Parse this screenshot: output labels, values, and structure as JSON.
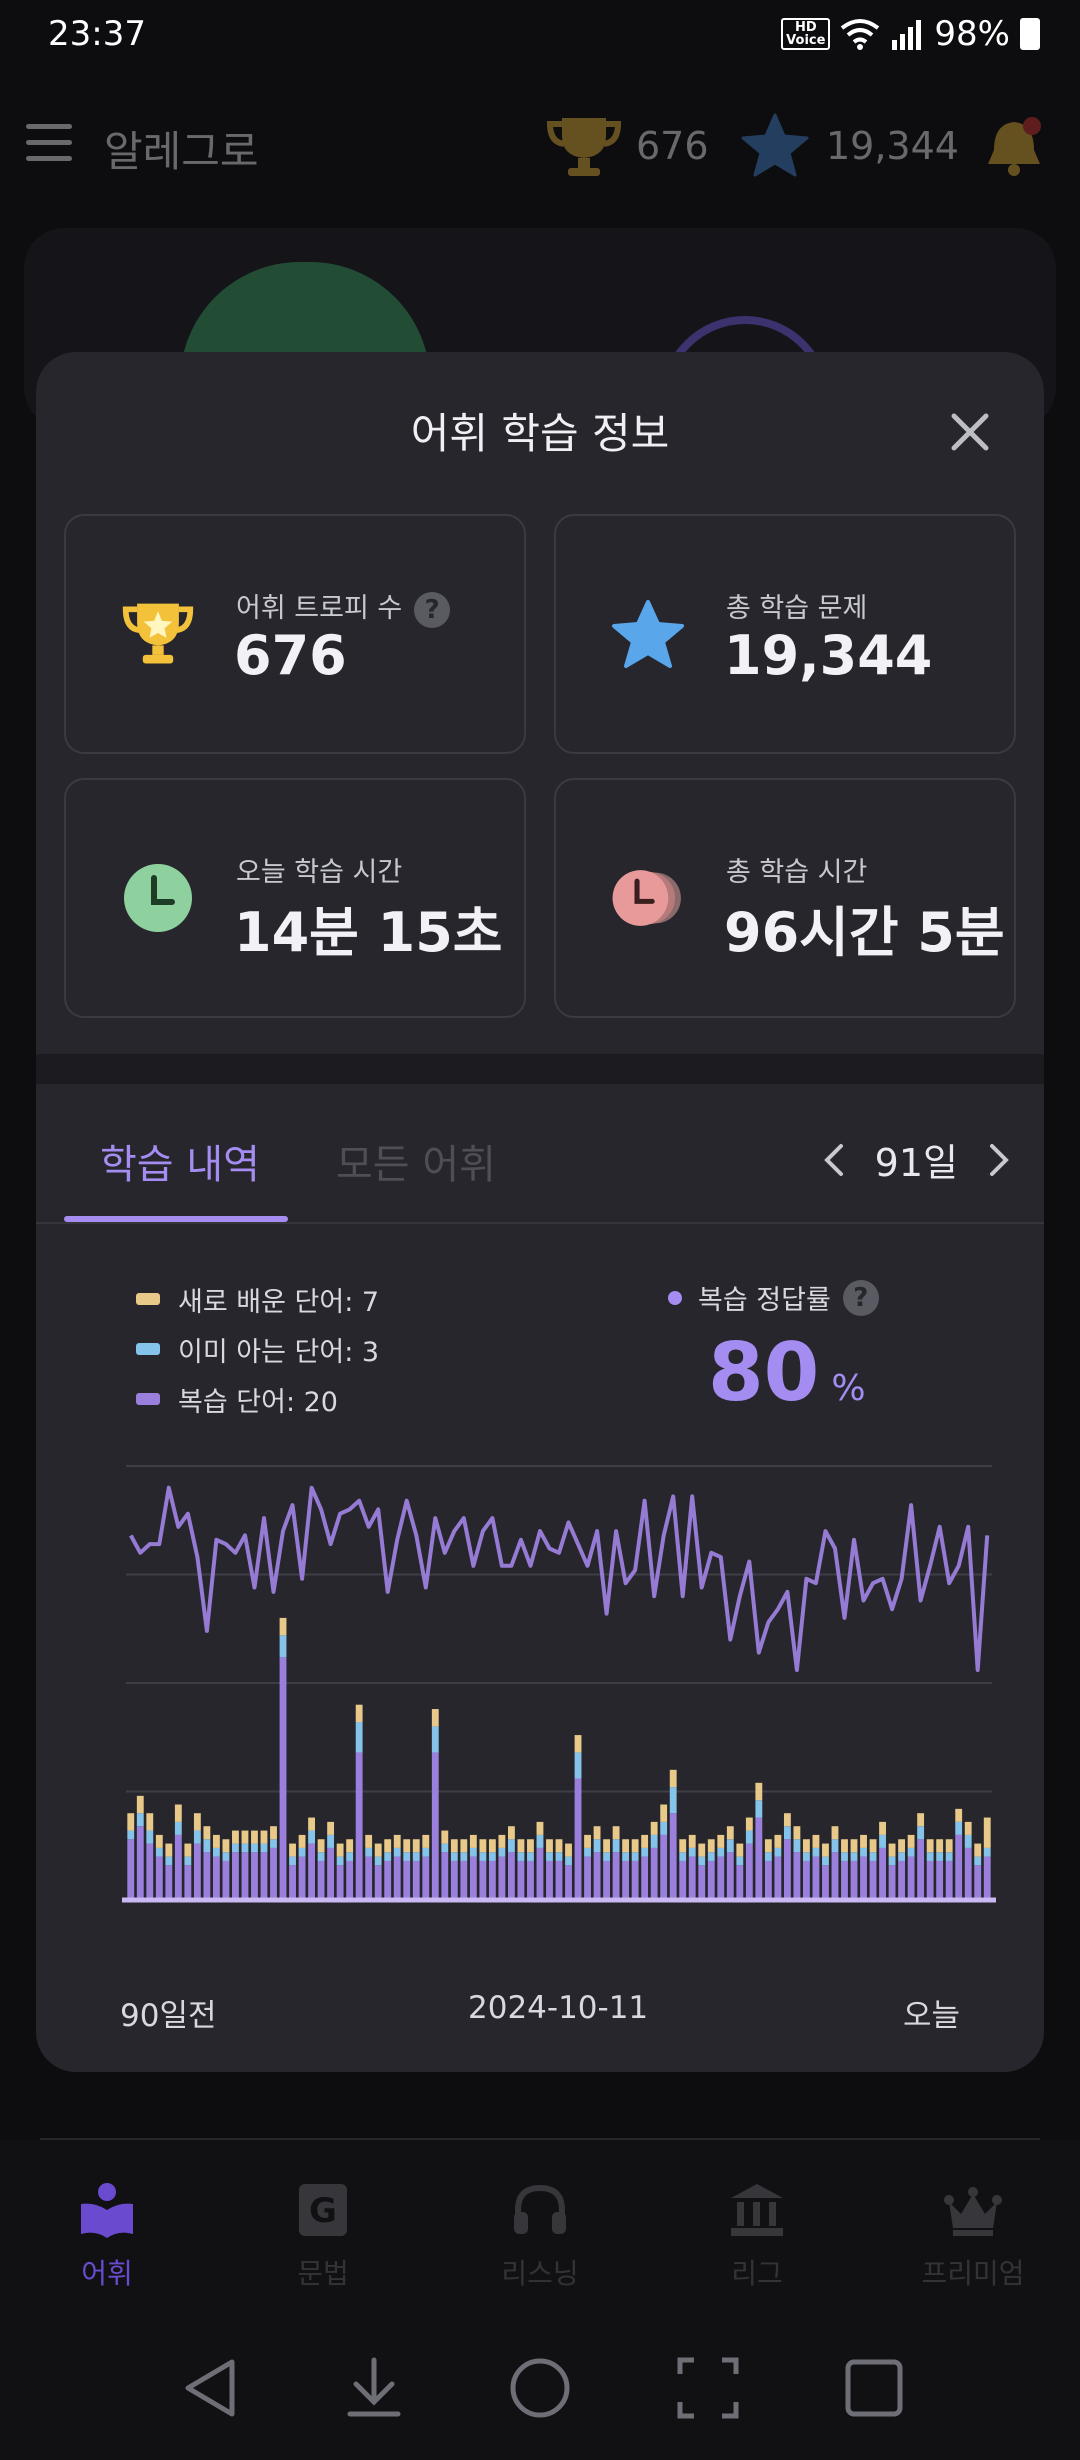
{
  "status": {
    "time": "23:37",
    "hd_top": "HD",
    "hd_bottom": "Voice",
    "battery": "98%"
  },
  "header": {
    "title": "알레그로",
    "trophy_count": "676",
    "star_count": "19,344"
  },
  "modal": {
    "title": "어휘 학습 정보",
    "stats": [
      {
        "label": "어휘 트로피 수",
        "value": "676",
        "help": "?"
      },
      {
        "label": "총 학습 문제",
        "value": "19,344"
      },
      {
        "label": "오늘 학습 시간",
        "value": "14분 15초"
      },
      {
        "label": "총 학습 시간",
        "value": "96시간 5분"
      }
    ],
    "tabs": [
      {
        "label": "학습 내역",
        "active": true
      },
      {
        "label": "모든 어휘",
        "active": false
      }
    ],
    "period": "91일",
    "legend": [
      {
        "label": "새로 배운 단어: 7",
        "color": "#e9c98a"
      },
      {
        "label": "이미 아는 단어: 3",
        "color": "#86c3ea"
      },
      {
        "label": "복습 단어: 20",
        "color": "#9b7fdc"
      }
    ],
    "review_rate": {
      "label": "복습 정답률",
      "help": "?",
      "value": "80",
      "unit": "%"
    }
  },
  "chart_data": {
    "type": "bar",
    "x_range": [
      "90일전",
      "오늘"
    ],
    "x_labels": [
      "90일전",
      "2024-10-11",
      "오늘"
    ],
    "series": [
      {
        "name": "복습 단어",
        "color": "#9b7fdc",
        "values": [
          14,
          17,
          13,
          10,
          8,
          15,
          8,
          13,
          11,
          10,
          9,
          11,
          11,
          11,
          11,
          12,
          56,
          8,
          10,
          13,
          9,
          12,
          8,
          9,
          34,
          10,
          8,
          9,
          10,
          9,
          9,
          10,
          34,
          11,
          9,
          9,
          10,
          9,
          9,
          10,
          11,
          9,
          9,
          12,
          9,
          9,
          8,
          28,
          10,
          11,
          9,
          11,
          9,
          9,
          10,
          12,
          15,
          20,
          9,
          10,
          8,
          9,
          10,
          11,
          8,
          13,
          19,
          9,
          10,
          14,
          11,
          9,
          10,
          8,
          11,
          9,
          9,
          10,
          9,
          12,
          8,
          9,
          10,
          14,
          9,
          9,
          9,
          15,
          12,
          8,
          10
        ]
      },
      {
        "name": "이미 아는 단어",
        "color": "#86c3ea",
        "values": [
          2,
          3,
          3,
          2,
          2,
          3,
          2,
          3,
          3,
          2,
          2,
          2,
          2,
          2,
          2,
          2,
          5,
          2,
          2,
          3,
          2,
          3,
          2,
          2,
          7,
          2,
          2,
          2,
          2,
          2,
          2,
          2,
          6,
          2,
          2,
          2,
          2,
          2,
          2,
          2,
          3,
          2,
          2,
          3,
          2,
          2,
          2,
          6,
          2,
          3,
          2,
          3,
          2,
          2,
          2,
          3,
          3,
          6,
          2,
          2,
          2,
          2,
          2,
          3,
          2,
          3,
          4,
          2,
          2,
          3,
          3,
          2,
          2,
          2,
          3,
          2,
          2,
          2,
          2,
          3,
          2,
          2,
          2,
          3,
          2,
          2,
          2,
          3,
          3,
          2,
          2
        ]
      },
      {
        "name": "새로 배운 단어",
        "color": "#e9c98a",
        "values": [
          4,
          4,
          4,
          3,
          3,
          4,
          3,
          4,
          3,
          3,
          3,
          3,
          3,
          3,
          3,
          3,
          4,
          3,
          3,
          3,
          3,
          3,
          3,
          3,
          4,
          3,
          3,
          3,
          3,
          3,
          3,
          3,
          4,
          3,
          3,
          3,
          3,
          3,
          3,
          3,
          3,
          3,
          3,
          3,
          3,
          3,
          3,
          4,
          3,
          3,
          3,
          3,
          3,
          3,
          3,
          3,
          4,
          4,
          3,
          3,
          3,
          3,
          3,
          3,
          3,
          3,
          4,
          3,
          3,
          3,
          3,
          3,
          3,
          3,
          3,
          3,
          3,
          3,
          3,
          3,
          3,
          3,
          3,
          3,
          3,
          3,
          3,
          3,
          3,
          3,
          7
        ]
      },
      {
        "name": "복습 정답률",
        "color": "#9b7fdc",
        "type": "line",
        "values": [
          84,
          80,
          82,
          82,
          95,
          86,
          89,
          79,
          62,
          83,
          82,
          80,
          84,
          72,
          88,
          71,
          85,
          91,
          74,
          95,
          90,
          82,
          89,
          90,
          92,
          86,
          90,
          71,
          83,
          92,
          84,
          72,
          88,
          80,
          85,
          88,
          77,
          85,
          88,
          77,
          77,
          83,
          77,
          85,
          81,
          80,
          87,
          82,
          77,
          85,
          66,
          85,
          73,
          76,
          92,
          70,
          84,
          93,
          70,
          93,
          72,
          80,
          79,
          60,
          70,
          78,
          57,
          64,
          67,
          71,
          53,
          74,
          73,
          85,
          81,
          65,
          83,
          69,
          73,
          74,
          67,
          74,
          91,
          69,
          77,
          86,
          73,
          77,
          86,
          53,
          84
        ]
      }
    ],
    "y_range": [
      0,
      100
    ],
    "grid": true
  },
  "nav": [
    {
      "label": "어휘",
      "icon": "book-person-icon",
      "active": true
    },
    {
      "label": "문법",
      "icon": "grammar-g-icon",
      "active": false
    },
    {
      "label": "리스닝",
      "icon": "headphones-icon",
      "active": false
    },
    {
      "label": "리그",
      "icon": "league-building-icon",
      "active": false
    },
    {
      "label": "프리미엄",
      "icon": "crown-icon",
      "active": false
    }
  ]
}
